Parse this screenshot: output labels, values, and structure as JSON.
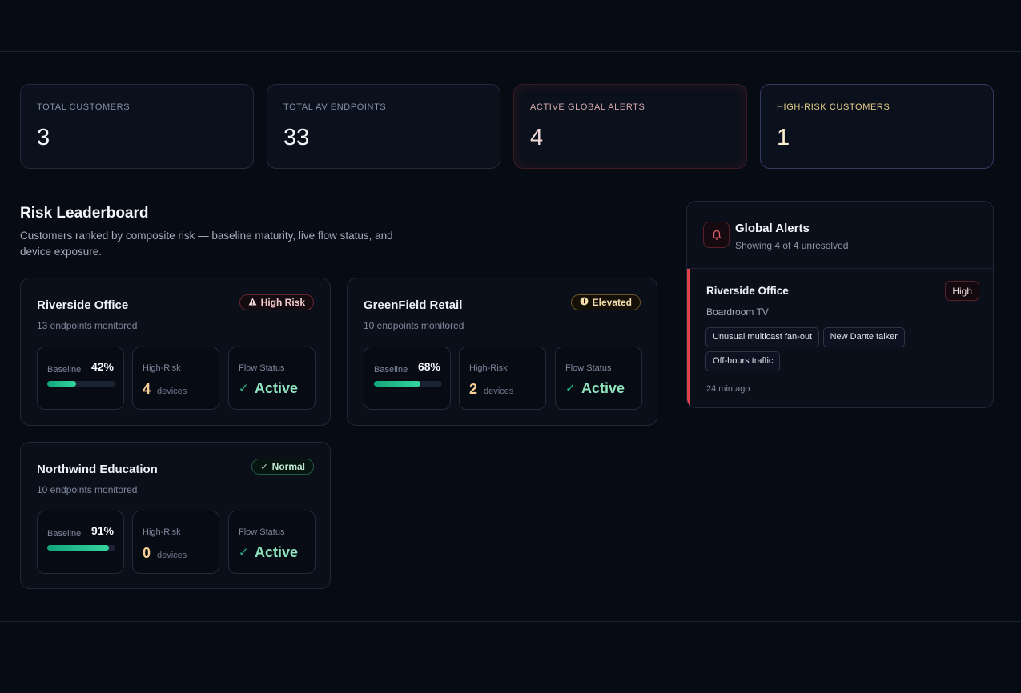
{
  "stats": [
    {
      "label": "TOTAL CUSTOMERS",
      "value": "3"
    },
    {
      "label": "TOTAL AV ENDPOINTS",
      "value": "33"
    },
    {
      "label": "ACTIVE GLOBAL ALERTS",
      "value": "4"
    },
    {
      "label": "HIGH-RISK CUSTOMERS",
      "value": "1"
    }
  ],
  "leaderboard": {
    "title": "Risk Leaderboard",
    "subtitle": "Customers ranked by composite risk — baseline maturity, live flow status, and device exposure.",
    "customers": [
      {
        "name": "Riverside Office",
        "endpoints": "13 endpoints monitored",
        "badge": "High Risk",
        "badge_icon": "warning-icon",
        "baseline_label": "Baseline",
        "baseline_pct": "42%",
        "baseline_fraction": 0.42,
        "highrisk_label": "High-Risk",
        "highrisk_count": "4",
        "highrisk_unit": "devices",
        "flow_label": "Flow Status",
        "flow_value": "Active"
      },
      {
        "name": "GreenField Retail",
        "endpoints": "10 endpoints monitored",
        "badge": "Elevated",
        "badge_icon": "info-circle-icon",
        "baseline_label": "Baseline",
        "baseline_pct": "68%",
        "baseline_fraction": 0.68,
        "highrisk_label": "High-Risk",
        "highrisk_count": "2",
        "highrisk_unit": "devices",
        "flow_label": "Flow Status",
        "flow_value": "Active"
      },
      {
        "name": "Northwind Education",
        "endpoints": "10 endpoints monitored",
        "badge": "Normal",
        "badge_icon": "check-icon",
        "baseline_label": "Baseline",
        "baseline_pct": "91%",
        "baseline_fraction": 0.91,
        "highrisk_label": "High-Risk",
        "highrisk_count": "0",
        "highrisk_unit": "devices",
        "flow_label": "Flow Status",
        "flow_value": "Active"
      }
    ]
  },
  "alerts": {
    "title": "Global Alerts",
    "subtitle": "Showing 4 of 4 unresolved",
    "items": [
      {
        "customer": "Riverside Office",
        "device": "Boardroom TV",
        "severity": "High",
        "tags": [
          "Unusual multicast fan-out",
          "New Dante talker",
          "Off-hours traffic"
        ],
        "time": "24 min ago"
      }
    ]
  },
  "colors": {
    "background": "#070b14",
    "accent_green": "#2fb889",
    "alert_red": "#e0404a",
    "warning_amber": "#e4cc8a"
  }
}
